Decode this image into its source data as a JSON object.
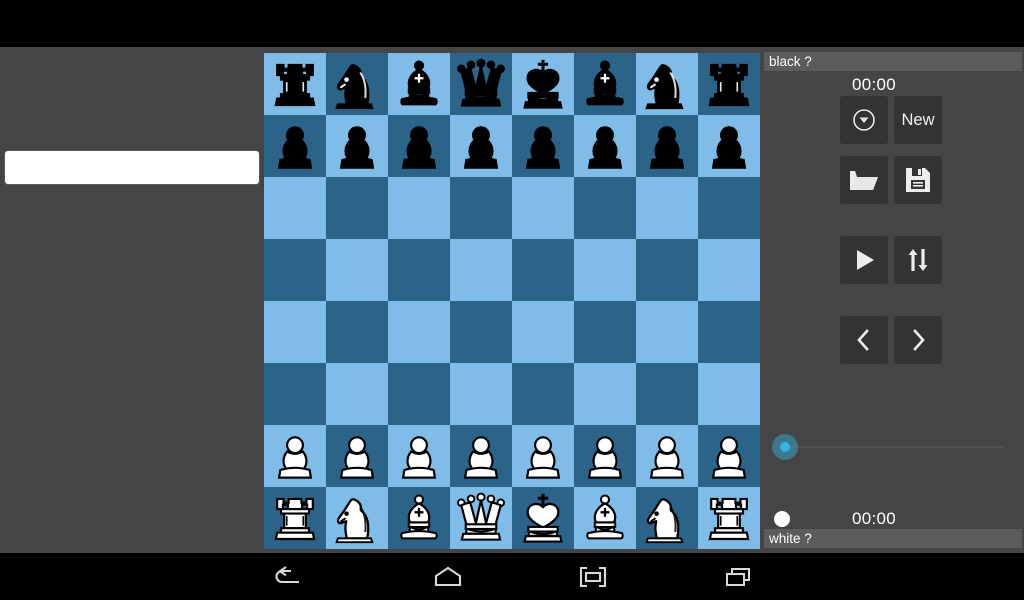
{
  "app": {
    "name": "chess-board-app",
    "background_color": "#454545",
    "status_bar_color": "#000000"
  },
  "left_panel": {
    "name": "move-list-panel",
    "move_list_text": ""
  },
  "board": {
    "light_square_color": "#7fbce8",
    "dark_square_color": "#2b6389",
    "orientation": "white-bottom",
    "files": [
      "a",
      "b",
      "c",
      "d",
      "e",
      "f",
      "g",
      "h"
    ],
    "ranks": [
      "8",
      "7",
      "6",
      "5",
      "4",
      "3",
      "2",
      "1"
    ],
    "position": [
      [
        "br",
        "bn",
        "bb",
        "bq",
        "bk",
        "bb",
        "bn",
        "br"
      ],
      [
        "bp",
        "bp",
        "bp",
        "bp",
        "bp",
        "bp",
        "bp",
        "bp"
      ],
      [
        "",
        "",
        "",
        "",
        "",
        "",
        "",
        ""
      ],
      [
        "",
        "",
        "",
        "",
        "",
        "",
        "",
        ""
      ],
      [
        "",
        "",
        "",
        "",
        "",
        "",
        "",
        ""
      ],
      [
        "",
        "",
        "",
        "",
        "",
        "",
        "",
        ""
      ],
      [
        "wp",
        "wp",
        "wp",
        "wp",
        "wp",
        "wp",
        "wp",
        "wp"
      ],
      [
        "wr",
        "wn",
        "wb",
        "wq",
        "wk",
        "wb",
        "wn",
        "wr"
      ]
    ]
  },
  "right_panel": {
    "black_player_label": "black ?",
    "black_clock": "00:00",
    "white_player_label": "white ?",
    "white_clock": "00:00",
    "turn_indicator": "white",
    "buttons": [
      {
        "name": "menu-button",
        "icon": "circle-chevron-down-icon",
        "label": ""
      },
      {
        "name": "new-game-button",
        "icon": "",
        "label": "New"
      },
      {
        "name": "open-button",
        "icon": "folder-open-icon",
        "label": ""
      },
      {
        "name": "save-button",
        "icon": "floppy-save-icon",
        "label": ""
      },
      {
        "name": "play-button",
        "icon": "play-icon",
        "label": ""
      },
      {
        "name": "flip-button",
        "icon": "swap-vertical-icon",
        "label": ""
      },
      {
        "name": "previous-move-button",
        "icon": "chevron-left-icon",
        "label": ""
      },
      {
        "name": "next-move-button",
        "icon": "chevron-right-icon",
        "label": ""
      }
    ],
    "seekbar": {
      "name": "move-seekbar",
      "value": 0,
      "min": 0,
      "max": 100,
      "thumb_color": "#33b5e5"
    }
  },
  "navbar": {
    "items": [
      {
        "name": "nav-back-button",
        "icon": "back-arrow-icon"
      },
      {
        "name": "nav-home-button",
        "icon": "home-icon"
      },
      {
        "name": "nav-fullscreen-button",
        "icon": "fullscreen-icon"
      },
      {
        "name": "nav-recents-button",
        "icon": "recent-apps-icon"
      }
    ]
  }
}
